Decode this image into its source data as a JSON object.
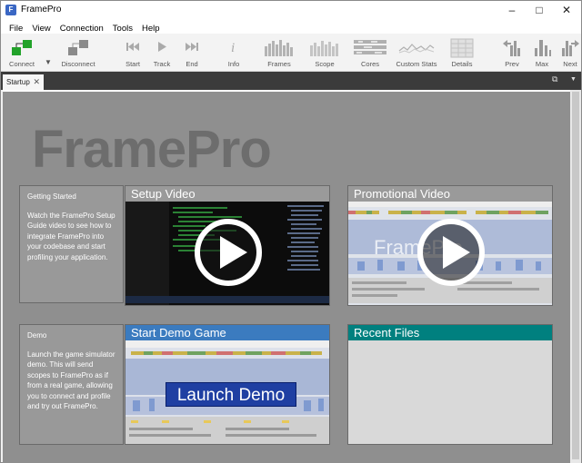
{
  "window": {
    "title": "FramePro"
  },
  "menu": [
    "File",
    "View",
    "Connection",
    "Tools",
    "Help"
  ],
  "toolbar": [
    {
      "label": "Connect",
      "icon": "connect-icon"
    },
    {
      "label": "Disconnect",
      "icon": "disconnect-icon"
    },
    {
      "label": "Start",
      "icon": "skip-start-icon"
    },
    {
      "label": "Track",
      "icon": "play-icon"
    },
    {
      "label": "End",
      "icon": "skip-end-icon"
    },
    {
      "label": "Info",
      "icon": "info-icon"
    },
    {
      "label": "Frames",
      "icon": "frames-bars-icon"
    },
    {
      "label": "Scope",
      "icon": "scope-bars-icon"
    },
    {
      "label": "Cores",
      "icon": "cores-icon"
    },
    {
      "label": "Custom Stats",
      "icon": "custom-stats-icon"
    },
    {
      "label": "Details",
      "icon": "details-grid-icon"
    },
    {
      "label": "Prev",
      "icon": "prev-icon"
    },
    {
      "label": "Max",
      "icon": "max-icon"
    },
    {
      "label": "Next",
      "icon": "next-icon"
    }
  ],
  "tabs": [
    {
      "label": "Startup"
    }
  ],
  "startup": {
    "logo": "FramePro",
    "getting_started": {
      "heading": "Getting Started",
      "text": "Watch the FramePro Setup Guide video to see how to integrate FramePro into your codebase and start profiling your application."
    },
    "demo": {
      "heading": "Demo",
      "text": "Launch the game simulator demo. This will send scopes to FramePro as if from a real game, allowing you to connect and profile and try out FramePro."
    },
    "setup_video": {
      "title": "Setup Video"
    },
    "promo_video": {
      "title": "Promotional Video",
      "watermark": "FramePro"
    },
    "demo_game": {
      "title": "Start Demo Game",
      "button": "Launch Demo"
    },
    "recent_files": {
      "title": "Recent Files"
    }
  },
  "colors": {
    "demo_header": "#3b7bbf",
    "recent_header": "#00807f",
    "content_bg": "#8f8f8f"
  }
}
